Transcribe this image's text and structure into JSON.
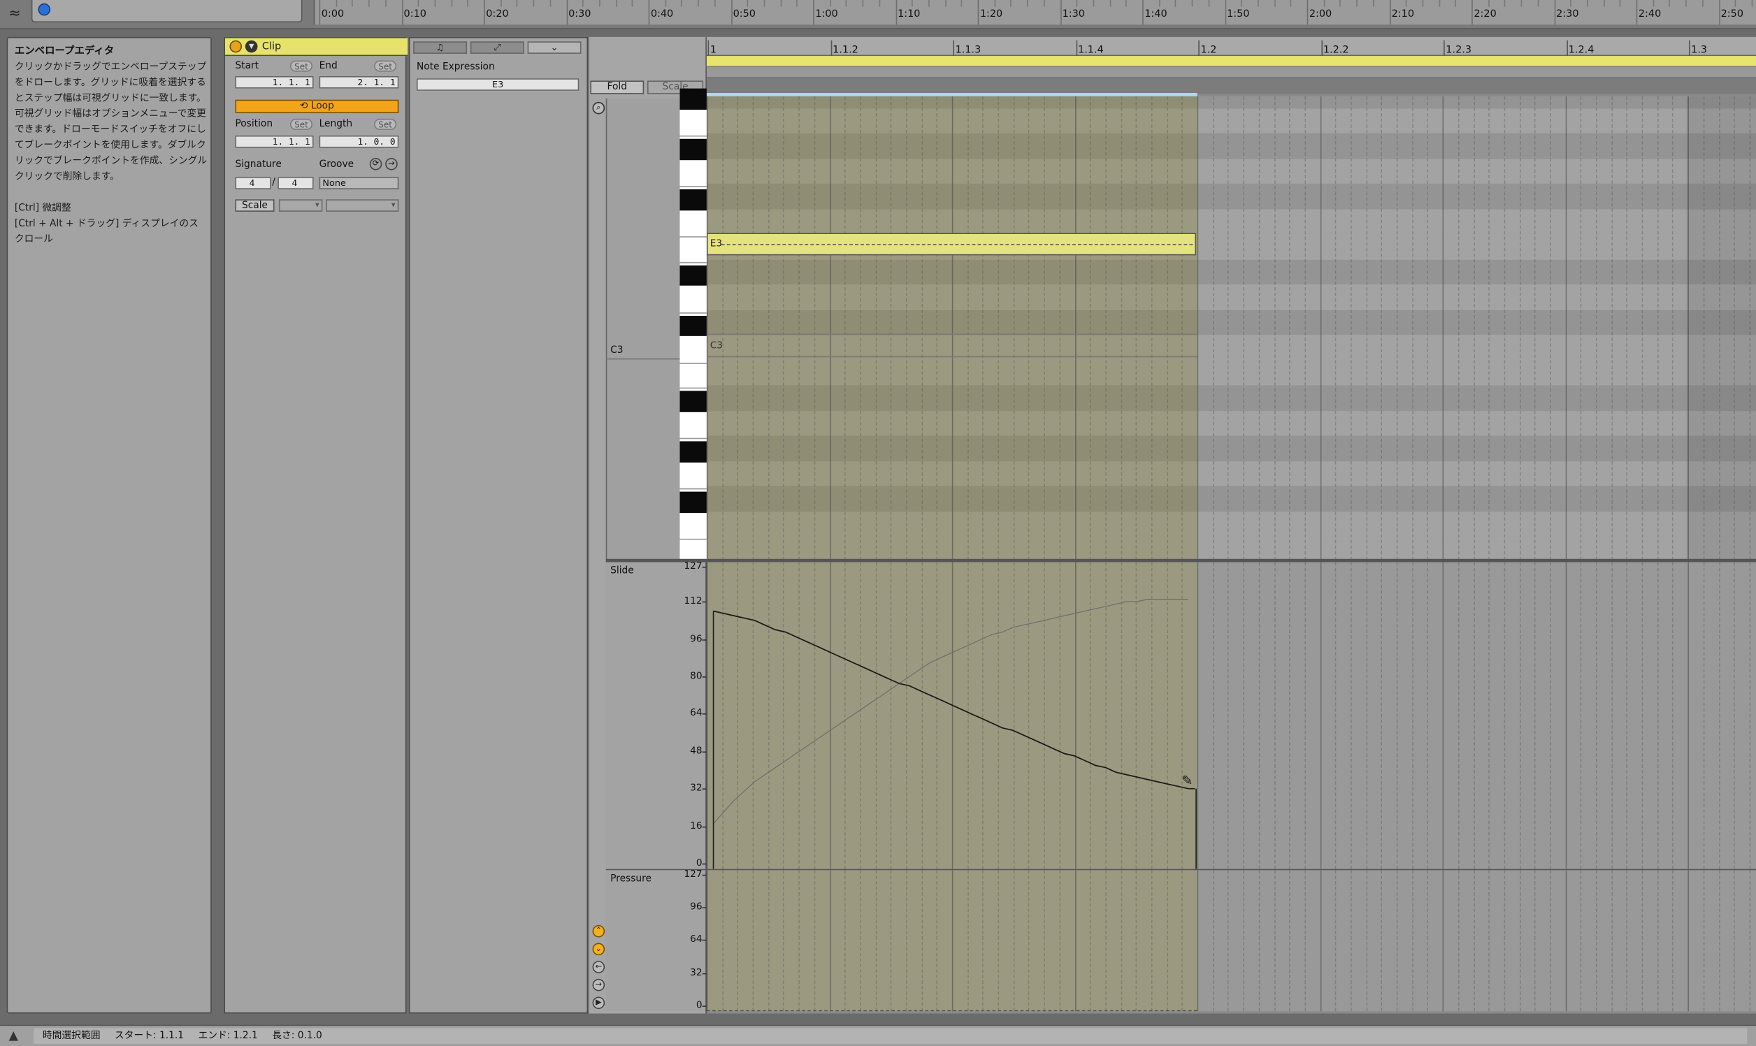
{
  "top": {
    "time_ruler": [
      "0:00",
      "0:10",
      "0:20",
      "0:30",
      "0:40",
      "0:50",
      "1:00",
      "1:10",
      "1:20",
      "1:30",
      "1:40",
      "1:50",
      "2:00",
      "2:10",
      "2:20",
      "2:30",
      "2:40",
      "2:50"
    ]
  },
  "info": {
    "title": "エンベロープエディタ",
    "body": "クリックかドラッグでエンベロープステップをドローします。グリッドに吸着を選択するとステップ幅は可視グリッドに一致します。可視グリッド幅はオプションメニューで変更できます。ドローモードスイッチをオフにしてブレークポイントを使用します。ダブルクリックでブレークポイントを作成、シングルクリックで削除します。\n\n[Ctrl] 微調整\n[Ctrl + Alt + ドラッグ] ディスプレイのスクロール"
  },
  "clip": {
    "title": "Clip",
    "start_label": "Start",
    "end_label": "End",
    "set_label": "Set",
    "start_value": "1.  1.  1",
    "end_value": "2.  1.  1",
    "loop_label": "Loop",
    "position_label": "Position",
    "length_label": "Length",
    "position_value": "1.  1.  1",
    "length_value": "1.  0.  0",
    "signature_label": "Signature",
    "groove_label": "Groove",
    "sig_num": "4",
    "sig_den": "4",
    "sig_slash": "/",
    "groove_value": "None",
    "scale_label": "Scale"
  },
  "envelope": {
    "tab_icons": [
      "note-icon",
      "curve-icon",
      "chevron-down-icon"
    ],
    "note_expression_label": "Note Expression",
    "note_expression_value": "E3"
  },
  "editor": {
    "fold_label": "Fold",
    "scale_label": "Scale",
    "beat_ruler": [
      "1",
      "1.1.2",
      "1.1.3",
      "1.1.4",
      "1.2",
      "1.2.2",
      "1.2.3",
      "1.2.4",
      "1.3"
    ],
    "c3_label": "C3",
    "note_label": "E3",
    "note_c3_label": "C3",
    "slide_label": "Slide",
    "slide_axis": [
      "127",
      "112",
      "96",
      "80",
      "64",
      "48",
      "32",
      "16",
      "0"
    ],
    "pressure_label": "Pressure",
    "pressure_axis": [
      "127",
      "96",
      "64",
      "32",
      "0"
    ],
    "slide_curve_primary": [
      108,
      107,
      106,
      105,
      104,
      102,
      100,
      99,
      97,
      95,
      93,
      91,
      89,
      87,
      85,
      83,
      81,
      79,
      77,
      76,
      74,
      72,
      70,
      68,
      66,
      64,
      62,
      60,
      58,
      57,
      55,
      53,
      51,
      49,
      47,
      46,
      44,
      42,
      41,
      39,
      38,
      37,
      36,
      35,
      34,
      33,
      32
    ],
    "slide_curve_secondary": [
      17,
      22,
      27,
      31,
      35,
      38,
      41,
      44,
      47,
      50,
      53,
      56,
      59,
      62,
      65,
      68,
      71,
      74,
      77,
      80,
      83,
      86,
      88,
      90,
      92,
      94,
      96,
      98,
      99,
      101,
      102,
      103,
      104,
      105,
      106,
      107,
      108,
      109,
      110,
      111,
      112,
      112,
      113,
      113,
      113,
      113,
      113
    ]
  },
  "status": {
    "range_label": "時間選択範囲",
    "start": "スタート: 1.1.1",
    "end": "エンド: 1.2.1",
    "length": "長さ: 0.1.0"
  },
  "colors": {
    "clip_header": "#e6e26a",
    "loop_orange": "#f4a419",
    "active_region": "#9b9a80"
  }
}
